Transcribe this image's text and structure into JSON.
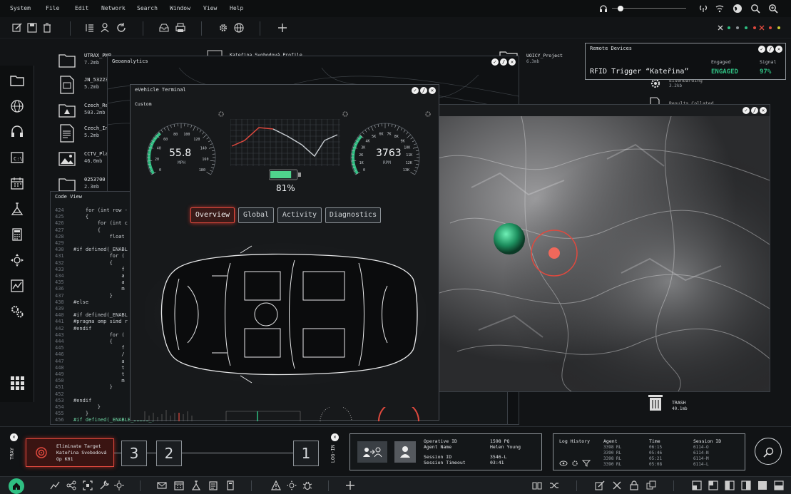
{
  "menu": [
    "System",
    "File",
    "Edit",
    "Network",
    "Search",
    "Window",
    "View",
    "Help"
  ],
  "desktop_files": [
    {
      "name": "UTRAX_PNP",
      "size": "7.2mb",
      "icon": "folder-icon"
    },
    {
      "name": "JN_53223",
      "size": "5.2mb",
      "icon": "image-file-icon"
    },
    {
      "name": "Czech_Re",
      "size": "503.2mb",
      "icon": "folder-icon"
    },
    {
      "name": "Czech_In",
      "size": "5.2mb",
      "icon": "document-icon"
    },
    {
      "name": "CCTV_Pla",
      "size": "46.0mb",
      "icon": "image-icon"
    },
    {
      "name": "0253700",
      "size": "2.3mb",
      "icon": "folder-icon"
    }
  ],
  "desktop_right": {
    "profile_name": "Kateřina Svobodová Profile",
    "project_name": "UOICY_Project",
    "project_size": "6.3mb",
    "file2_name": "Eisenbarding",
    "file2_size": "3.2kb",
    "file3_name": "Results Collated",
    "trash_name": "TRASH",
    "trash_size": "40.1mb"
  },
  "geoanalytics": {
    "title": "Geoanalytics"
  },
  "code_view": {
    "title": "Code View",
    "lines": [
      {
        "n": "424",
        "t": "    for (int row -"
      },
      {
        "n": "425",
        "t": "    {"
      },
      {
        "n": "426",
        "t": "        for (int c"
      },
      {
        "n": "427",
        "t": "        {"
      },
      {
        "n": "428",
        "t": "            float"
      },
      {
        "n": "429",
        "t": ""
      },
      {
        "n": "430",
        "t": "#if defined(_ENABL"
      },
      {
        "n": "431",
        "t": "            for ("
      },
      {
        "n": "432",
        "t": "            {"
      },
      {
        "n": "433",
        "t": "                f"
      },
      {
        "n": "434",
        "t": "                a"
      },
      {
        "n": "435",
        "t": "                a"
      },
      {
        "n": "436",
        "t": "                m"
      },
      {
        "n": "437",
        "t": "            }"
      },
      {
        "n": "438",
        "t": "#else"
      },
      {
        "n": "439",
        "t": ""
      },
      {
        "n": "440",
        "t": "#if defined(_ENABL"
      },
      {
        "n": "441",
        "t": "#pragma omp simd r"
      },
      {
        "n": "442",
        "t": "#endif"
      },
      {
        "n": "443",
        "t": "            for ("
      },
      {
        "n": "444",
        "t": "            {"
      },
      {
        "n": "445",
        "t": "                f"
      },
      {
        "n": "446",
        "t": "                /"
      },
      {
        "n": "447",
        "t": "                a"
      },
      {
        "n": "448",
        "t": "                t"
      },
      {
        "n": "449",
        "t": "                t"
      },
      {
        "n": "450",
        "t": "                m"
      },
      {
        "n": "451",
        "t": "            }"
      },
      {
        "n": "452",
        "t": ""
      },
      {
        "n": "453",
        "t": "#endif"
      },
      {
        "n": "454",
        "t": "        }"
      },
      {
        "n": "455",
        "t": "    }"
      },
      {
        "n": "456",
        "t": "#if defined(_ENABLE_DEBUG_)"
      }
    ]
  },
  "terminal": {
    "title": "eVehicle Terminal",
    "subtitle": "Custom",
    "speed": "55.8",
    "speed_unit": "MPH",
    "rpm": "3763",
    "rpm_unit": "RPM",
    "battery": "81%",
    "battery_level": 0.81,
    "speed_ticks": [
      "0",
      "20",
      "40",
      "60",
      "80",
      "100",
      "120",
      "140",
      "160",
      "180"
    ],
    "rpm_ticks": [
      "0",
      "1K",
      "2K",
      "3K",
      "4K",
      "5K",
      "6K",
      "7K",
      "8K",
      "9K",
      "10K",
      "11K",
      "12K",
      "13K"
    ],
    "tabs": [
      "Overview",
      "Global",
      "Activity",
      "Diagnostics"
    ],
    "active_tab": "Overview"
  },
  "remote_devices": {
    "title": "Remote Devices",
    "name": "RFID Trigger “Kateřina”",
    "engaged_label": "Engaged",
    "engaged_value": "ENGAGED",
    "signal_label": "Signal",
    "signal_value": "97%"
  },
  "tray": {
    "label": "TRAY",
    "task_title": "Eliminate Target",
    "task_name": "Kateřina Svobodová",
    "task_op": "Op K01",
    "steps": [
      "3",
      "2",
      "1"
    ],
    "login_label": "LOG-IN"
  },
  "operative": {
    "id_label": "Operative ID",
    "id_value": "1598 PQ",
    "agent_label": "Agent Name",
    "agent_value": "Helen Young",
    "session_label": "Session ID",
    "session_value": "3546-L",
    "timeout_label": "Session Timeout",
    "timeout_value": "03:41"
  },
  "log_history": {
    "title": "Log History",
    "headers": [
      "Agent",
      "Time",
      "Session ID"
    ],
    "rows": [
      [
        "3398 RL",
        "06:15",
        "6114-O"
      ],
      [
        "3390 RL",
        "05:46",
        "6114-N"
      ],
      [
        "3398 RL",
        "05:21",
        "6114-M"
      ],
      [
        "3390 RL",
        "05:08",
        "6114-L"
      ]
    ]
  },
  "colors": {
    "accent_red": "#e1493e",
    "accent_green": "#2fbf82"
  }
}
